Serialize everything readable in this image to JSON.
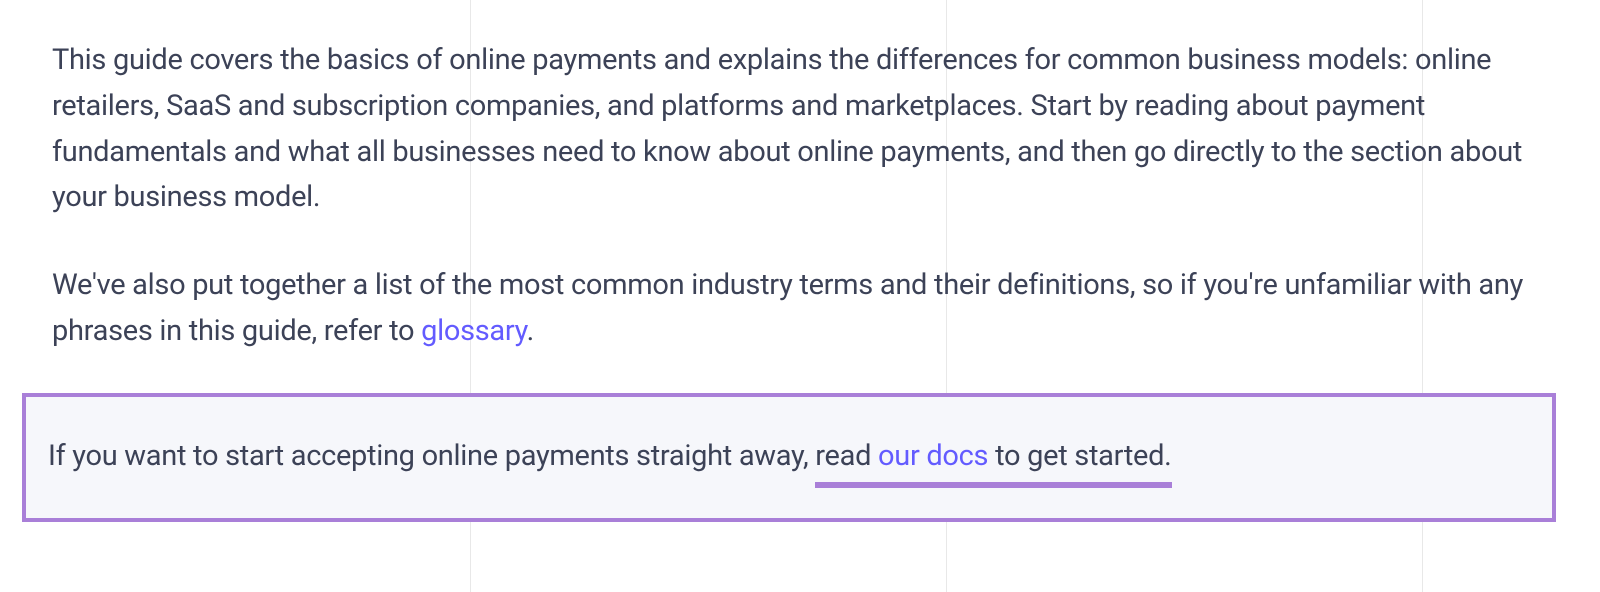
{
  "para1": "This guide covers the basics of online payments and explains the differences for common business models: online retailers, SaaS and subscription companies, and platforms and marketplaces. Start by reading about payment fundamentals and what all businesses need to know about online payments, and then go directly to the section about your business model.",
  "para2_before": "We've also put together a list of the most common industry terms and their definitions, so if you're unfamiliar with any phrases in this guide, refer to ",
  "para2_link": "glossary",
  "para2_after": ".",
  "callout_before": "If you want to start accepting online payments straight away, ",
  "callout_underlined_before": "read ",
  "callout_link": "our docs",
  "callout_underlined_after": " to get started.",
  "colors": {
    "text": "#3c4257",
    "link": "#635bff",
    "accent_border": "#a97fd8",
    "callout_bg": "#f6f7fb"
  }
}
